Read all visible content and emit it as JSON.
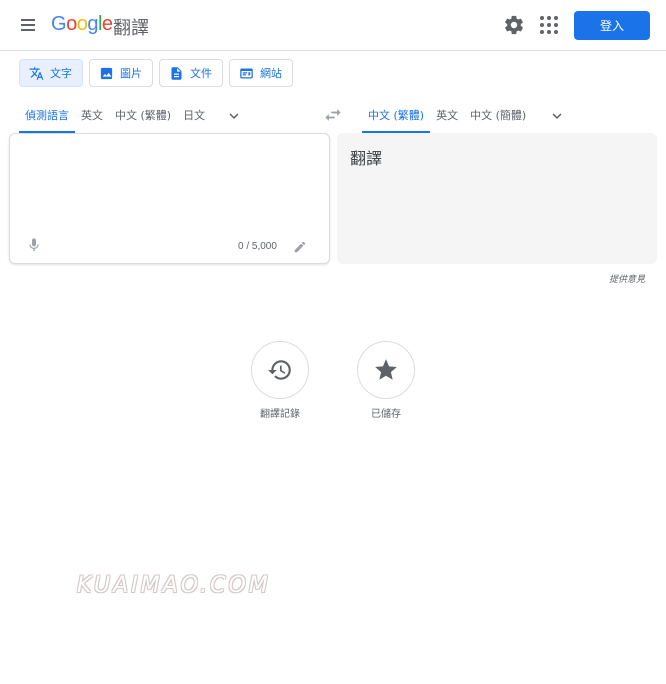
{
  "header": {
    "logo": [
      "G",
      "o",
      "o",
      "g",
      "l",
      "e"
    ],
    "product_name": "翻譯",
    "signin_label": "登入"
  },
  "modes": [
    {
      "label": "文字",
      "icon": "translate-icon",
      "active": true
    },
    {
      "label": "圖片",
      "icon": "image-icon",
      "active": false
    },
    {
      "label": "文件",
      "icon": "document-icon",
      "active": false
    },
    {
      "label": "網站",
      "icon": "website-icon",
      "active": false
    }
  ],
  "source_langs": {
    "tabs": [
      "偵測語言",
      "英文",
      "中文 (繁體)",
      "日文"
    ],
    "active_index": 0
  },
  "target_langs": {
    "tabs": [
      "中文 (繁體)",
      "英文",
      "中文 (簡體)"
    ],
    "active_index": 0
  },
  "source": {
    "value": "",
    "char_count": "0 / 5,000"
  },
  "target": {
    "placeholder_text": "翻譯"
  },
  "feedback_label": "提供意見",
  "actions": {
    "history_label": "翻譯記錄",
    "saved_label": "已儲存"
  },
  "watermark": "KUAIMAO.COM",
  "colors": {
    "accent": "#1a73e8",
    "active_mode_bg": "#e8f0fe",
    "target_bg": "#f5f5f5",
    "divider": "#dadce0"
  }
}
